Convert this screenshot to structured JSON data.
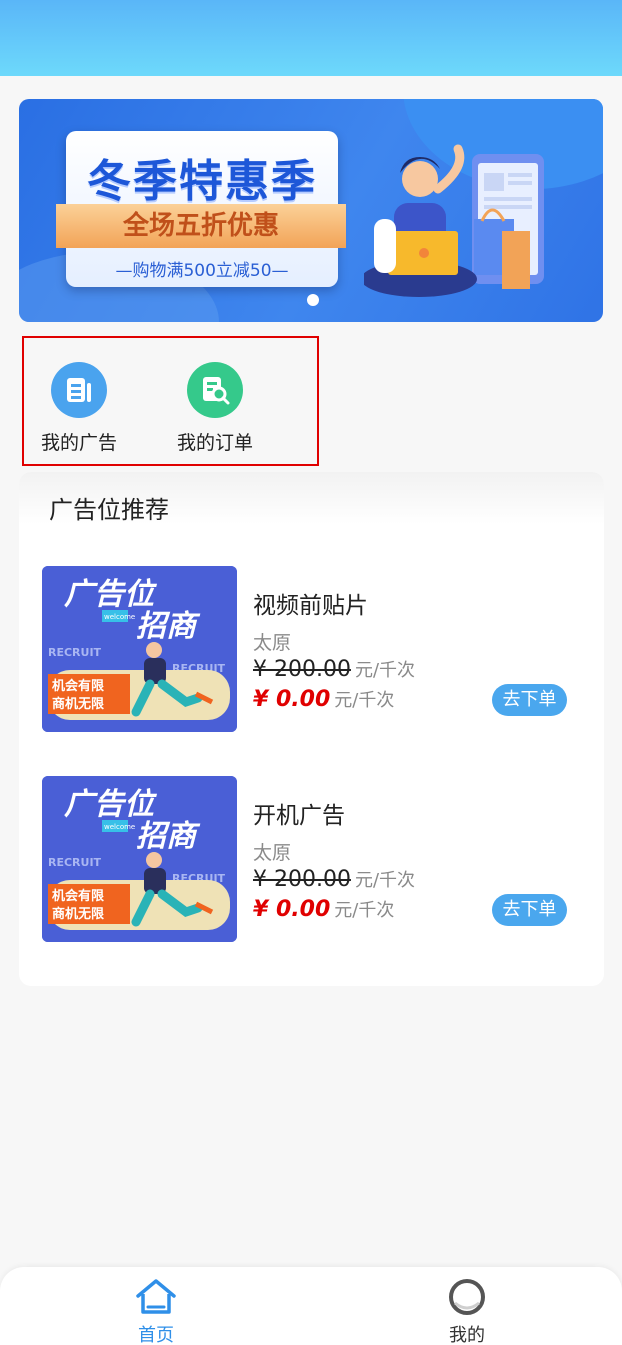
{
  "banner": {
    "title": "冬季特惠季",
    "ribbon": "全场五折优惠",
    "subtitle": "—购物满500立减50—"
  },
  "quick_menu": [
    {
      "label": "我的广告",
      "icon": "document-icon",
      "color": "#4aa3ee"
    },
    {
      "label": "我的订单",
      "icon": "order-search-icon",
      "color": "#35c98b"
    }
  ],
  "section": {
    "title": "广告位推荐"
  },
  "ads": [
    {
      "name": "视频前贴片",
      "city": "太原",
      "original_price": "¥ 200.00",
      "current_price": "¥ 0.00",
      "unit": "元/千次",
      "button": "去下单",
      "thumb": {
        "line1": "广告位",
        "line2": "招商",
        "tag": "RECRUIT",
        "tag2": "RECRUIT",
        "box1": "机会有限",
        "box2": "商机无限",
        "badge": "welcome"
      }
    },
    {
      "name": "开机广告",
      "city": "太原",
      "original_price": "¥ 200.00",
      "current_price": "¥ 0.00",
      "unit": "元/千次",
      "button": "去下单",
      "thumb": {
        "line1": "广告位",
        "line2": "招商",
        "tag": "RECRUIT",
        "tag2": "RECRUIT",
        "box1": "机会有限",
        "box2": "商机无限",
        "badge": "welcome"
      }
    }
  ],
  "tabbar": [
    {
      "label": "首页",
      "icon": "home-icon",
      "active": true,
      "color": "#2f8fe8"
    },
    {
      "label": "我的",
      "icon": "profile-icon",
      "active": false,
      "color": "#333333"
    }
  ]
}
